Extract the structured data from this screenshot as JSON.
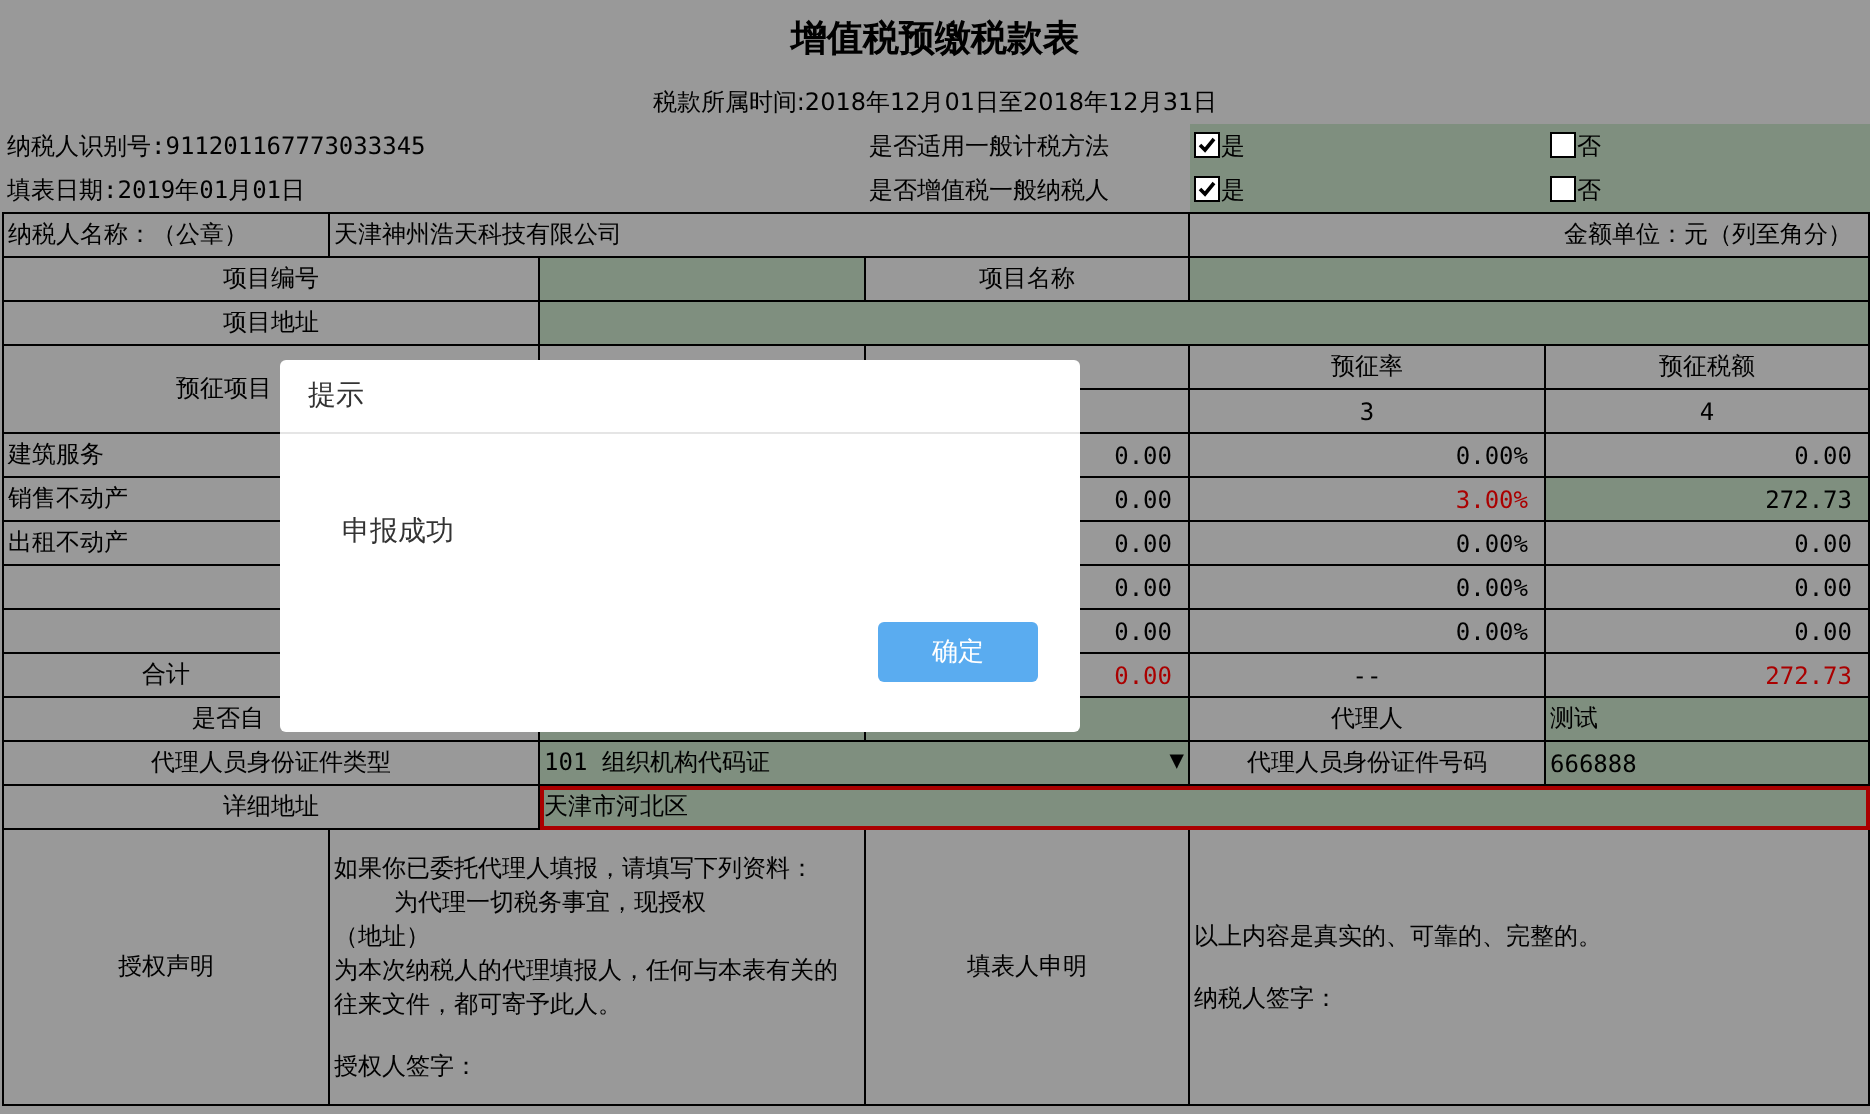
{
  "title": "增值税预缴税款表",
  "period": "税款所属时间:2018年12月01日至2018年12月31日",
  "header_rows": [
    {
      "info": "纳税人识别号:911201167773033345",
      "question": "是否适用一般计税方法",
      "options": [
        {
          "label": "是",
          "checked": true
        },
        {
          "label": "否",
          "checked": false
        }
      ]
    },
    {
      "info": "填表日期:2019年01月01日",
      "question": "是否增值税一般纳税人",
      "options": [
        {
          "label": "是",
          "checked": true
        },
        {
          "label": "否",
          "checked": false
        }
      ]
    }
  ],
  "taxpayer": {
    "label": "纳税人名称：（公章）",
    "name": "天津神州浩天科技有限公司",
    "unit_note": "金额单位：元（列至角分）"
  },
  "project": {
    "number_label": "项目编号",
    "name_label": "项目名称",
    "address_label": "项目地址"
  },
  "items_header": {
    "label": "预征项目",
    "columns": [
      {
        "label": "预征率",
        "index": "3"
      },
      {
        "label": "预征税额",
        "index": "4"
      }
    ]
  },
  "items": [
    {
      "name": "建筑服务",
      "deduction": "0.00",
      "rate": "0.00%",
      "tax": "0.00",
      "highlighted": false
    },
    {
      "name": "销售不动产",
      "deduction": "0.00",
      "rate": "3.00%",
      "tax": "272.73",
      "highlighted": true
    },
    {
      "name": "出租不动产",
      "deduction": "0.00",
      "rate": "0.00%",
      "tax": "0.00",
      "highlighted": false
    },
    {
      "deduction": "0.00",
      "rate": "0.00%",
      "tax": "0.00",
      "highlighted": false
    },
    {
      "deduction": "0.00",
      "rate": "0.00%",
      "tax": "0.00",
      "highlighted": false
    }
  ],
  "total": {
    "label": "合计",
    "deduction": "0.00",
    "rate": "--",
    "tax": "272.73"
  },
  "agent": {
    "self_label": "是否自",
    "agent_label": "代理人",
    "agent_value": "测试",
    "id_type_label": "代理人员身份证件类型",
    "id_type_value": "101 组织机构代码证",
    "dropdown_arrow": "▼",
    "id_number_label": "代理人员身份证件号码",
    "id_number_value": "666888",
    "address_label": "详细地址",
    "address_value": "天津市河北区",
    "address_invalid": true
  },
  "declarations": {
    "auth_label": "授权声明",
    "auth_lines": [
      "如果你已委托代理人填报，请填写下列资料：",
      "为代理一切税务事宜，现授权",
      "（地址）",
      "为本次纳税人的代理填报人，任何与本表有关的往来文件，都可寄予此人。",
      "授权人签字："
    ],
    "filler_label": "填表人申明",
    "filler_lines": [
      "以上内容是真实的、可靠的、完整的。",
      "纳税人签字："
    ]
  },
  "dialog": {
    "title": "提示",
    "message": "申报成功",
    "button": "确定"
  }
}
